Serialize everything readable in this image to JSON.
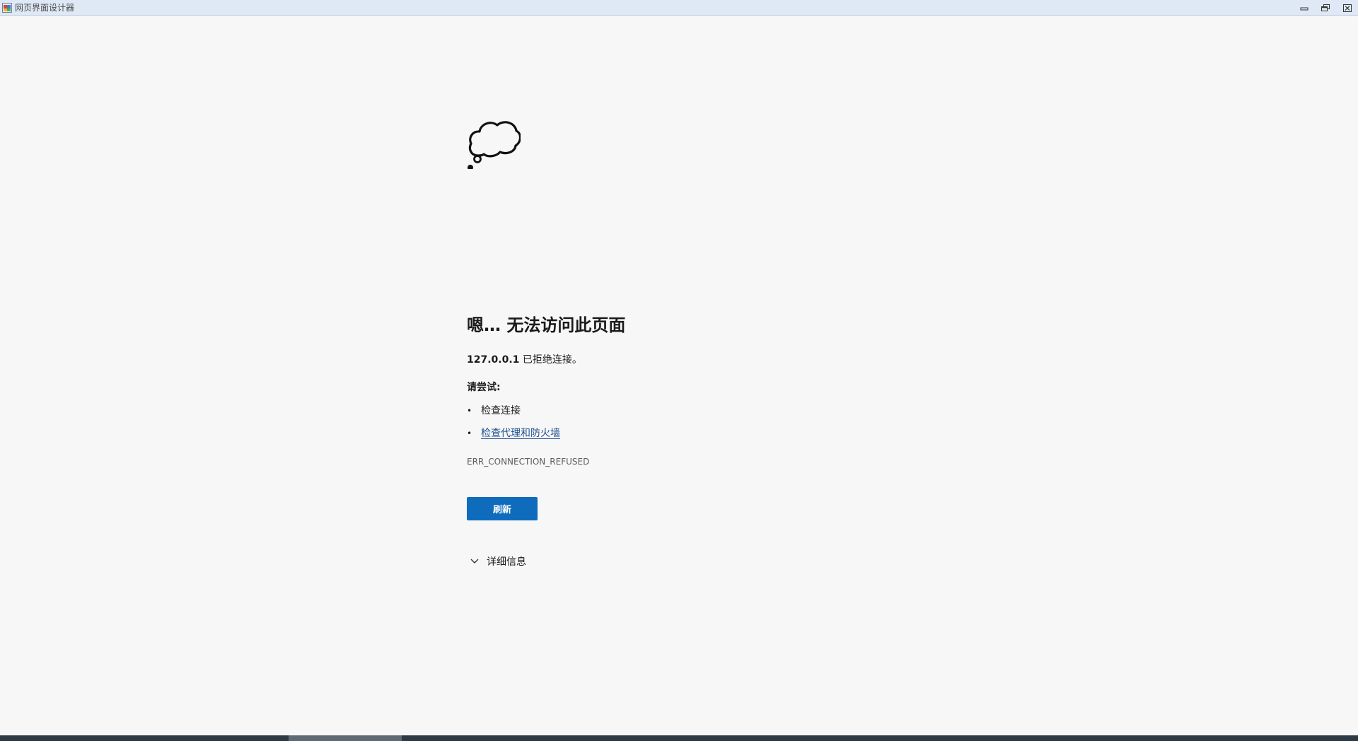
{
  "window": {
    "title": "网页界面设计器"
  },
  "icons": {
    "app": "app-window-icon",
    "minimize": "minimize-icon",
    "restore": "restore-icon",
    "close": "close-icon",
    "cloud": "thought-cloud-icon",
    "chevron": "chevron-down-icon"
  },
  "error": {
    "headline": "嗯… 无法访问此页面",
    "host": "127.0.0.1",
    "host_message": " 已拒绝连接。",
    "try_label": "请尝试:",
    "suggestions": [
      {
        "text": "检查连接",
        "link": false
      },
      {
        "text": "检查代理和防火墙",
        "link": true
      }
    ],
    "code": "ERR_CONNECTION_REFUSED",
    "refresh_label": "刷新",
    "details_label": "详细信息"
  },
  "colors": {
    "page_bg": "#f7f7f7",
    "accent": "#0f6cbd",
    "link": "#1f4f8f",
    "titlebar_bg": "#dfe8f5"
  }
}
